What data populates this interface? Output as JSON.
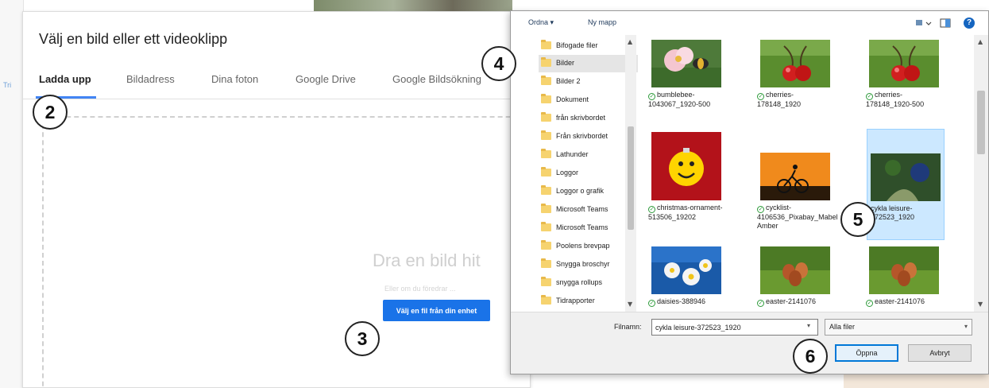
{
  "background": {
    "left_fragment": "Tri"
  },
  "picker": {
    "title": "Välj en bild eller ett videoklipp",
    "tabs": [
      "Ladda upp",
      "Bildadress",
      "Dina foton",
      "Google Drive",
      "Google Bildsökning"
    ],
    "drop_text": "Dra en bild hit",
    "or_text": "Eller om du föredrar ...",
    "select_button": "Välj en fil från din enhet"
  },
  "dialog": {
    "organize": "Ordna",
    "new_folder": "Ny mapp",
    "help": "?",
    "nav_items": [
      "Bifogade filer",
      "Bilder",
      "Bilder 2",
      "Dokument",
      "från skrivbordet",
      "Från skrivbordet",
      "Lathunder",
      "Loggor",
      "Loggor o grafik",
      "Microsoft Teams",
      "Microsoft Teams",
      "Poolens brevpap",
      "Snygga broschyr",
      "snygga rollups",
      "Tidrapporter"
    ],
    "selected_nav": "Bilder",
    "files": [
      {
        "name": "bumblebee-1043067_1920-500",
        "icon": "flower-photo"
      },
      {
        "name": "cherries-178148_1920",
        "icon": "cherries-photo"
      },
      {
        "name": "cherries-178148_1920-500",
        "icon": "cherries-photo"
      },
      {
        "name": "christmas-ornament-513506_19202",
        "icon": "ornament-photo"
      },
      {
        "name": "cycklist-4106536_Pixabay_Mabel Amber",
        "icon": "cyclist-photo"
      },
      {
        "name": "cykla leisure-372523_1920",
        "icon": "forest-photo"
      },
      {
        "name": "daisies-388946",
        "icon": "daisies-photo"
      },
      {
        "name": "easter-2141076",
        "icon": "eggs-photo"
      },
      {
        "name": "easter-2141076",
        "icon": "eggs-photo"
      }
    ],
    "filename_label": "Filnamn:",
    "filename_value": "cykla leisure-372523_1920",
    "filetype": "Alla filer",
    "open_button": "Öppna",
    "cancel_button": "Avbryt"
  },
  "markers": [
    "2",
    "3",
    "4",
    "5",
    "6"
  ]
}
